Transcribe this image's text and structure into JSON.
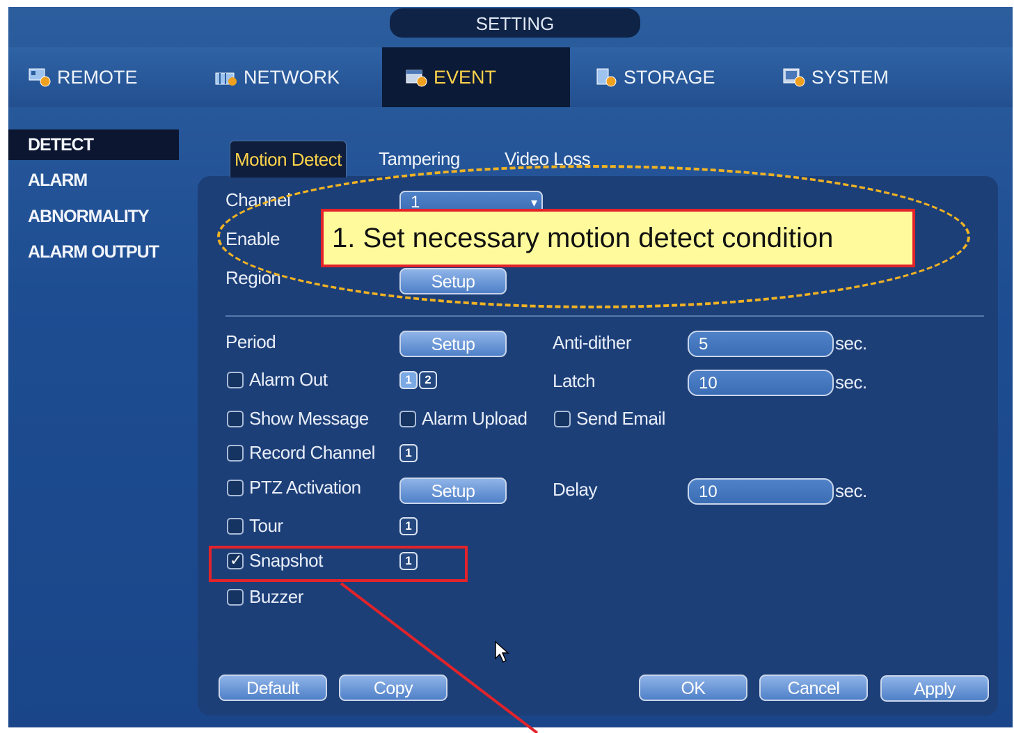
{
  "window": {
    "title": "SETTING"
  },
  "top_tabs": [
    {
      "label": "REMOTE",
      "icon": "remote-gear-icon"
    },
    {
      "label": "NETWORK",
      "icon": "network-gear-icon"
    },
    {
      "label": "EVENT",
      "icon": "event-gear-icon",
      "active": true
    },
    {
      "label": "STORAGE",
      "icon": "storage-gear-icon"
    },
    {
      "label": "SYSTEM",
      "icon": "system-gear-icon"
    }
  ],
  "left_menu": [
    {
      "label": "DETECT",
      "active": true
    },
    {
      "label": "ALARM"
    },
    {
      "label": "ABNORMALITY"
    },
    {
      "label": "ALARM OUTPUT"
    }
  ],
  "sub_tabs": [
    {
      "label": "Motion Detect",
      "active": true
    },
    {
      "label": "Tampering"
    },
    {
      "label": "Video Loss"
    }
  ],
  "form": {
    "channel_label": "Channel",
    "channel_value": "1",
    "enable_label": "Enable",
    "region_label": "Region",
    "region_button": "Setup",
    "period_label": "Period",
    "period_button": "Setup",
    "anti_dither_label": "Anti-dither",
    "anti_dither_value": "5",
    "anti_dither_unit": "sec.",
    "alarm_out_label": "Alarm Out",
    "alarm_out_channels": [
      "1",
      "2"
    ],
    "latch_label": "Latch",
    "latch_value": "10",
    "latch_unit": "sec.",
    "show_message_label": "Show Message",
    "alarm_upload_label": "Alarm Upload",
    "send_email_label": "Send Email",
    "record_channel_label": "Record Channel",
    "record_channel_value": "1",
    "ptz_activation_label": "PTZ Activation",
    "ptz_button": "Setup",
    "delay_label": "Delay",
    "delay_value": "10",
    "delay_unit": "sec.",
    "tour_label": "Tour",
    "tour_value": "1",
    "snapshot_label": "Snapshot",
    "snapshot_checked": true,
    "snapshot_value": "1",
    "buzzer_label": "Buzzer"
  },
  "buttons": {
    "default": "Default",
    "copy": "Copy",
    "ok": "OK",
    "cancel": "Cancel",
    "apply": "Apply"
  },
  "annotation": {
    "callout_text": "1. Set necessary  motion detect condition",
    "ellipse_color": "#f0b323",
    "highlight_color": "#e2232a"
  }
}
